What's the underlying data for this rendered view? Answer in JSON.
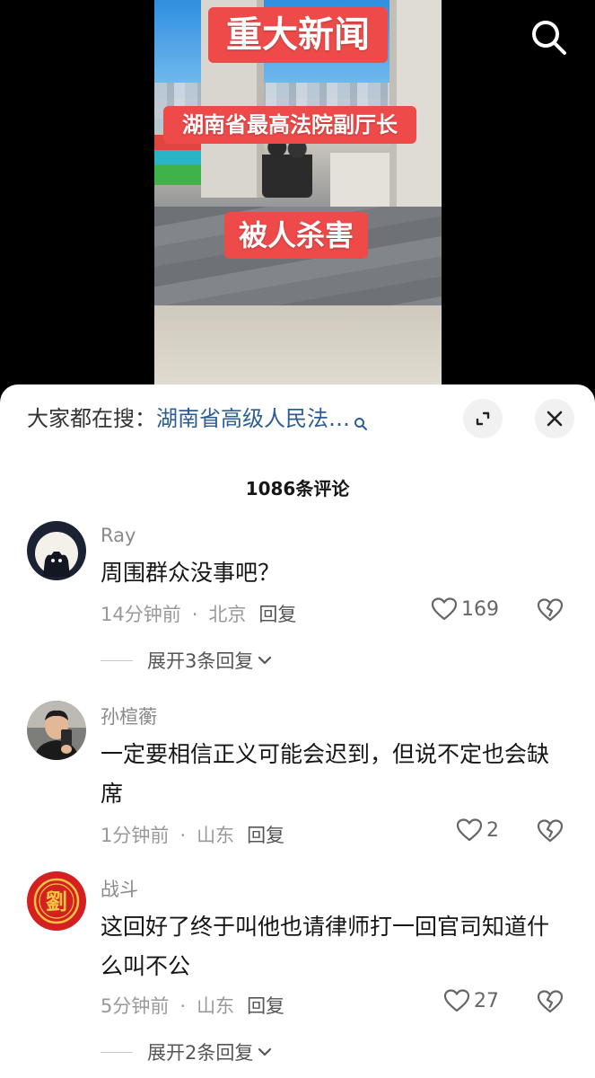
{
  "video": {
    "caption_1": "重大新闻",
    "caption_2": "湖南省最高法院副厅长",
    "caption_3": "被人杀害"
  },
  "sheet": {
    "hot_search_label": "大家都在搜：",
    "hot_search_link": "湖南省高级人民法…",
    "comment_count": "1086条评论"
  },
  "comments": [
    {
      "user": "Ray",
      "text": "周围群众没事吧？",
      "time": "14分钟前",
      "location": "北京",
      "reply": "回复",
      "likes": "169",
      "expand": "展开3条回复"
    },
    {
      "user": "孙楦蘅",
      "text": "一定要相信正义可能会迟到，但说不定也会缺席",
      "time": "1分钟前",
      "location": "山东",
      "reply": "回复",
      "likes": "2"
    },
    {
      "user": "战斗",
      "text": "这回好了终于叫他也请律师打一回官司知道什么叫不公",
      "time": "5分钟前",
      "location": "山东",
      "reply": "回复",
      "likes": "27",
      "expand": "展开2条回复",
      "avatar_glyph": "劉"
    }
  ],
  "colors": {
    "caption_bg": "#ef4a4a",
    "link": "#2d5d95",
    "avatar3_bg": "#d42020"
  },
  "icons": [
    "search-icon",
    "expand-icon",
    "close-icon",
    "heart-icon",
    "dislike-heart-icon",
    "chevron-down-icon"
  ]
}
